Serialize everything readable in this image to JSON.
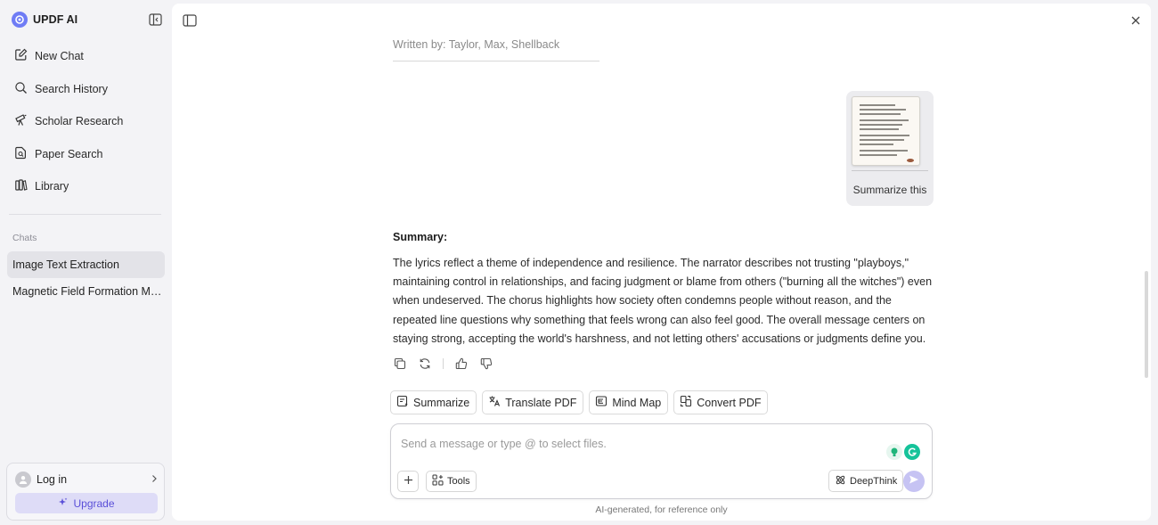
{
  "brand": {
    "name": "UPDF AI",
    "accent": "#6f7cf5"
  },
  "sidebar": {
    "nav": [
      {
        "label": "New Chat",
        "icon": "edit-icon"
      },
      {
        "label": "Search History",
        "icon": "search-icon"
      },
      {
        "label": "Scholar Research",
        "icon": "telescope-icon"
      },
      {
        "label": "Paper Search",
        "icon": "document-search-icon"
      },
      {
        "label": "Library",
        "icon": "library-icon"
      }
    ],
    "chats_label": "Chats",
    "chats": [
      {
        "title": "Image Text Extraction",
        "active": true
      },
      {
        "title": "Magnetic Field Formation Me...",
        "active": false
      }
    ],
    "account": {
      "login_label": "Log in",
      "upgrade_label": "Upgrade"
    }
  },
  "conversation": {
    "written_by": "Written by: Taylor, Max, Shellback",
    "user_message": {
      "text": "Summarize this",
      "attachment": "image-thumbnail"
    },
    "assistant": {
      "title": "Summary:",
      "body": "The lyrics reflect a theme of independence and resilience. The narrator describes not trusting \"playboys,\" maintaining control in relationships, and facing judgment or blame from others (\"burning all the witches\") even when undeserved. The chorus highlights how society often condemns people without reason, and the repeated line questions why something that feels wrong can also feel good. The overall message centers on staying strong, accepting the world's harshness, and not letting others' accusations or judgments define you."
    }
  },
  "quick_actions": [
    "Summarize",
    "Translate PDF",
    "Mind Map",
    "Convert PDF"
  ],
  "composer": {
    "placeholder": "Send a message or type @ to select files.",
    "value": "",
    "tools_label": "Tools",
    "deepthink_label": "DeepThink"
  },
  "footnote": "AI-generated, for reference only",
  "colors": {
    "send": "#c6c3f3",
    "upgrade_bg": "#dedcf7",
    "upgrade_text": "#5a4fd8",
    "grammarly": "#15c39a"
  }
}
